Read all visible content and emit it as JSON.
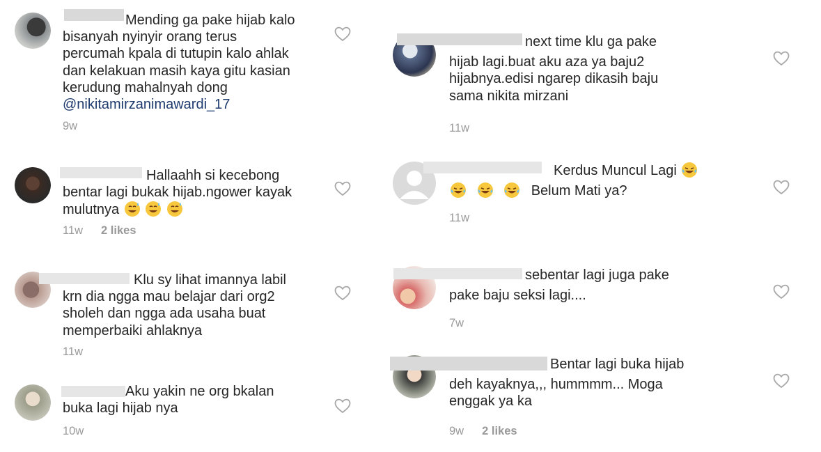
{
  "comments_left": [
    {
      "lines": [
        "Mending ga pake hijab kalo",
        "bisanyah nyinyir orang terus",
        "percumah kpala di tutupin kalo ahlak",
        "dan kelakuan masih kaya gitu kasian",
        "kerudung mahalnyah dong"
      ],
      "mention": "@nikitamirzanimawardi_17",
      "time": "9w",
      "likes": ""
    },
    {
      "lines": [
        "Hallaahh si kecebong",
        "bentar lagi bukak hijab.ngower kayak",
        "mulutnya"
      ],
      "time": "11w",
      "likes": "2 likes",
      "emoji": "sweat-smile-emoji"
    },
    {
      "lines": [
        "Klu sy lihat imannya labil",
        "krn dia ngga mau belajar dari org2",
        "sholeh dan ngga ada usaha buat",
        "memperbaiki ahlaknya"
      ],
      "time": "11w",
      "likes": ""
    },
    {
      "lines": [
        "Aku yakin ne org bkalan",
        "buka lagi hijab nya"
      ],
      "time": "10w",
      "likes": ""
    }
  ],
  "comments_right": [
    {
      "lines": [
        "next time klu ga pake",
        "hijab lagi.buat aku aza ya baju2",
        "hijabnya.edisi ngarep dikasih baju",
        "sama nikita mirzani"
      ],
      "time": "11w",
      "likes": ""
    },
    {
      "lines": [
        "Kerdus Muncul Lagi",
        "Belum Mati ya?"
      ],
      "time": "11w",
      "likes": "",
      "emoji": "tears-of-joy-emoji"
    },
    {
      "lines": [
        "sebentar lagi juga pake",
        "pake baju seksi lagi...."
      ],
      "time": "7w",
      "likes": ""
    },
    {
      "lines": [
        "Bentar lagi buka hijab",
        "deh kayaknya,,, hummmm... Moga",
        "enggak ya ka"
      ],
      "time": "9w",
      "likes": "2 likes"
    }
  ],
  "icons": {
    "like": "heart-outline-icon",
    "default_avatar": "person-silhouette-icon"
  },
  "colors": {
    "text": "#262626",
    "meta": "#999999",
    "mention": "#1d3a6e",
    "heart": "#a8a8a8"
  }
}
